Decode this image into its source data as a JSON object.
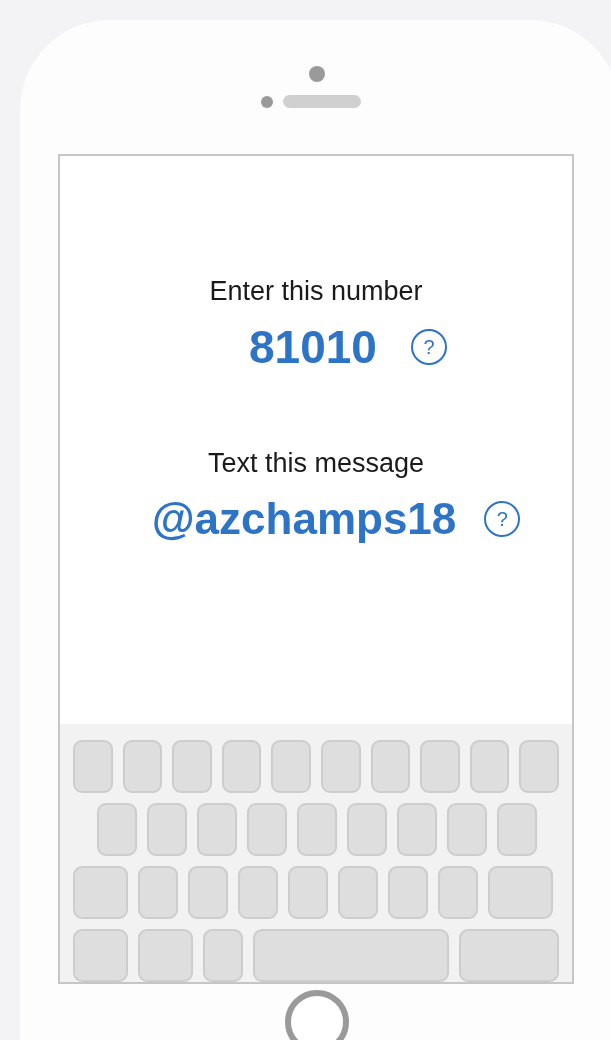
{
  "prompts": [
    {
      "kind": "number",
      "label": "Enter this number",
      "value": "81010",
      "help": "?"
    },
    {
      "kind": "message",
      "label": "Text this message",
      "value": "@azchamps18",
      "help": "?"
    }
  ]
}
